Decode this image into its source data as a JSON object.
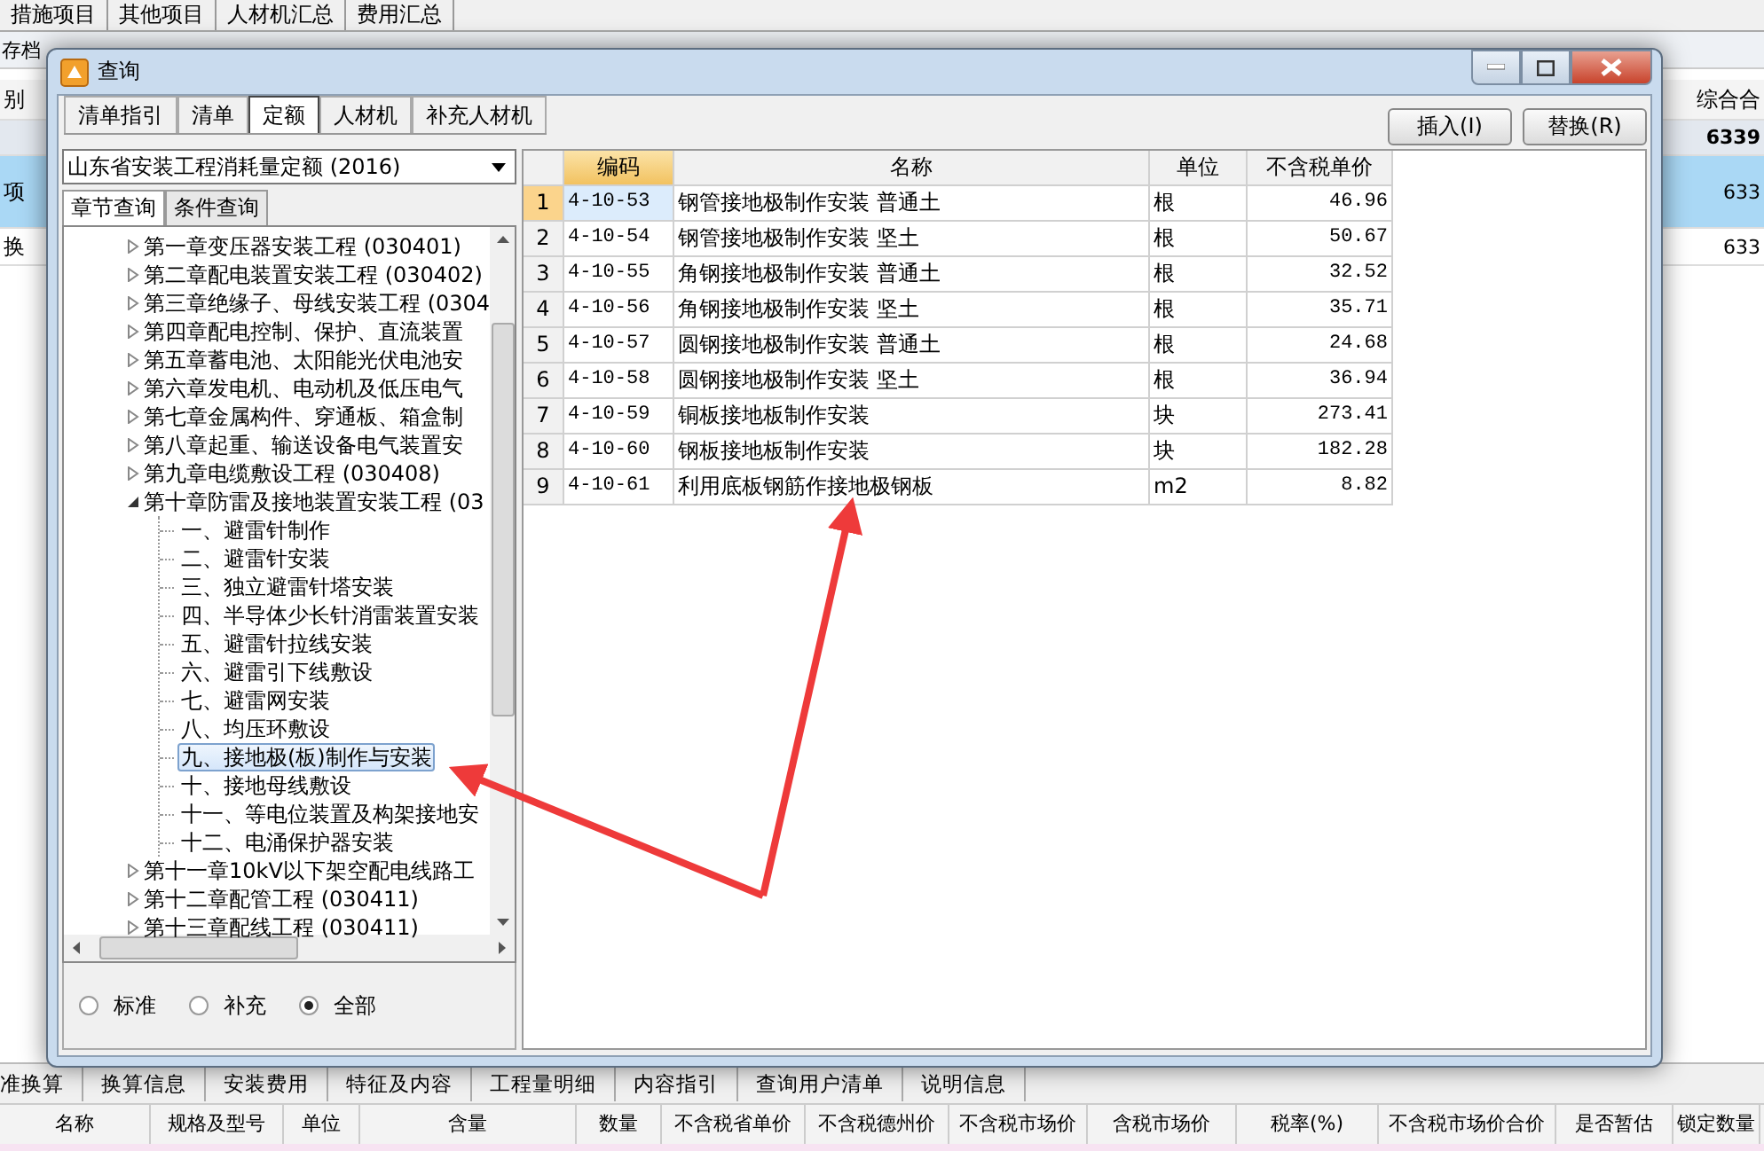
{
  "app": {
    "top_tabs": [
      "措施项目",
      "其他项目",
      "人材机汇总",
      "费用汇总"
    ],
    "toolbar": {
      "label": "存档"
    },
    "grid": {
      "columns": [
        "别",
        "综合合"
      ],
      "rows": [
        {
          "kind": "summary",
          "col_1": "",
          "total": "6339",
          "selected": false
        },
        {
          "kind": "item",
          "col_1": "项",
          "total": "633",
          "selected": true
        },
        {
          "kind": "item",
          "col_1": "换",
          "total": "633",
          "selected": false
        }
      ]
    },
    "bottom_tabs": [
      "准换算",
      "换算信息",
      "安装费用",
      "特征及内容",
      "工程量明细",
      "内容指引",
      "查询用户清单",
      "说明信息"
    ],
    "bottom_columns": [
      "名称",
      "规格及型号",
      "单位",
      "含量",
      "数量",
      "不含税省单价",
      "不含税德州价",
      "不含税市场价",
      "含税市场价",
      "税率(%)",
      "不含税市场价合价",
      "是否暂估",
      "锁定数量"
    ]
  },
  "dialog": {
    "title": "查询",
    "tabs": [
      {
        "label": "清单指引",
        "selected": false
      },
      {
        "label": "清单",
        "selected": false
      },
      {
        "label": "定额",
        "selected": true
      },
      {
        "label": "人材机",
        "selected": false
      },
      {
        "label": "补充人材机",
        "selected": false
      }
    ],
    "buttons": [
      "插入(I)",
      "替换(R)"
    ],
    "library": "山东省安装工程消耗量定额 (2016)",
    "search_tabs": [
      {
        "label": "章节查询",
        "selected": true
      },
      {
        "label": "条件查询",
        "selected": false
      }
    ],
    "tree": [
      {
        "label": "第一章变压器安装工程 (030401)",
        "expanded": false
      },
      {
        "label": "第二章配电装置安装工程 (030402)",
        "expanded": false
      },
      {
        "label": "第三章绝缘子、母线安装工程 (0304",
        "expanded": false
      },
      {
        "label": "第四章配电控制、保护、直流装置",
        "expanded": false
      },
      {
        "label": "第五章蓄电池、太阳能光伏电池安",
        "expanded": false
      },
      {
        "label": "第六章发电机、电动机及低压电气",
        "expanded": false
      },
      {
        "label": "第七章金属构件、穿通板、箱盒制",
        "expanded": false
      },
      {
        "label": "第八章起重、输送设备电气装置安",
        "expanded": false
      },
      {
        "label": "第九章电缆敷设工程 (030408)",
        "expanded": false
      },
      {
        "label": "第十章防雷及接地装置安装工程 (03",
        "expanded": true,
        "children": [
          {
            "label": "一、避雷针制作",
            "selected": false
          },
          {
            "label": "二、避雷针安装",
            "selected": false
          },
          {
            "label": "三、独立避雷针塔安装",
            "selected": false
          },
          {
            "label": "四、半导体少长针消雷装置安装",
            "selected": false
          },
          {
            "label": "五、避雷针拉线安装",
            "selected": false
          },
          {
            "label": "六、避雷引下线敷设",
            "selected": false
          },
          {
            "label": "七、避雷网安装",
            "selected": false
          },
          {
            "label": "八、均压环敷设",
            "selected": false
          },
          {
            "label": "九、接地极(板)制作与安装",
            "selected": true
          },
          {
            "label": "十、接地母线敷设",
            "selected": false
          },
          {
            "label": "十一、等电位装置及构架接地安",
            "selected": false
          },
          {
            "label": "十二、电涌保护器安装",
            "selected": false
          }
        ]
      },
      {
        "label": "第十一章10kV以下架空配电线路工",
        "expanded": false
      },
      {
        "label": "第十二章配管工程 (030411)",
        "expanded": false
      },
      {
        "label": "第十三章配线工程 (030411)",
        "expanded": false
      }
    ],
    "scope": [
      {
        "label": "标准",
        "selected": false
      },
      {
        "label": "补充",
        "selected": false
      },
      {
        "label": "全部",
        "selected": true
      }
    ],
    "table": {
      "columns": [
        "编码",
        "名称",
        "单位",
        "不含税单价"
      ],
      "rows": [
        {
          "index": "1",
          "code": "4-10-53",
          "name": "钢管接地极制作安装 普通土",
          "unit": "根",
          "price": "46.96",
          "selected": true
        },
        {
          "index": "2",
          "code": "4-10-54",
          "name": "钢管接地极制作安装 坚土",
          "unit": "根",
          "price": "50.67",
          "selected": false
        },
        {
          "index": "3",
          "code": "4-10-55",
          "name": "角钢接地极制作安装 普通土",
          "unit": "根",
          "price": "32.52",
          "selected": false
        },
        {
          "index": "4",
          "code": "4-10-56",
          "name": "角钢接地极制作安装 坚土",
          "unit": "根",
          "price": "35.71",
          "selected": false
        },
        {
          "index": "5",
          "code": "4-10-57",
          "name": "圆钢接地极制作安装 普通土",
          "unit": "根",
          "price": "24.68",
          "selected": false
        },
        {
          "index": "6",
          "code": "4-10-58",
          "name": "圆钢接地极制作安装 坚土",
          "unit": "根",
          "price": "36.94",
          "selected": false
        },
        {
          "index": "7",
          "code": "4-10-59",
          "name": "铜板接地板制作安装",
          "unit": "块",
          "price": "273.41",
          "selected": false
        },
        {
          "index": "8",
          "code": "4-10-60",
          "name": "钢板接地板制作安装",
          "unit": "块",
          "price": "182.28",
          "selected": false
        },
        {
          "index": "9",
          "code": "4-10-61",
          "name": "利用底板钢筋作接地极钢板",
          "unit": "m2",
          "price": "8.82",
          "selected": false
        }
      ]
    }
  }
}
